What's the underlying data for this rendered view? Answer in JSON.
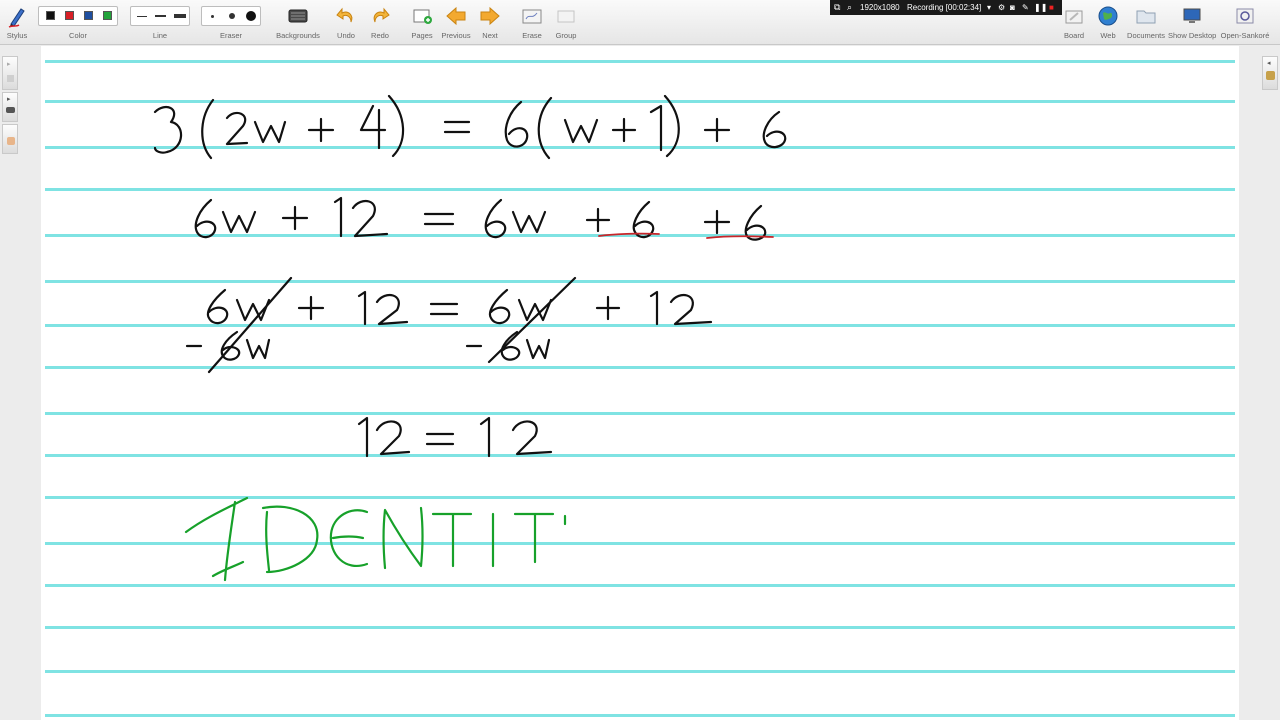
{
  "toolbar": {
    "stylus": "Stylus",
    "color": "Color",
    "line": "Line",
    "eraser": "Eraser",
    "backgrounds": "Backgrounds",
    "undo": "Undo",
    "redo": "Redo",
    "pages": "Pages",
    "previous": "Previous",
    "next": "Next",
    "erase": "Erase",
    "group": "Group",
    "board": "Board",
    "web": "Web",
    "documents": "Documents",
    "show_desktop": "Show Desktop",
    "open_sankore": "Open-Sankoré"
  },
  "colors": {
    "swatches": [
      "#111111",
      "#d81f26",
      "#1f4fa0",
      "#23a33b"
    ],
    "guideline": "#7fe3e3",
    "ink": "#111111",
    "ink_green": "#17a12a",
    "ink_red": "#c8262a"
  },
  "recording": {
    "resolution": "1920x1080",
    "status": "Recording [00:02:34]"
  },
  "board": {
    "line1": "3(2w + 4) = 6(w + 1) + 6",
    "line2": "6w + 12 = 6w + 6 + 6",
    "line3_left": "6w + 12",
    "line3_eq": "=",
    "line3_right": "6w + 12",
    "line3_sub_left": "−6w",
    "line3_sub_right": "−6w",
    "line4": "12 = 12",
    "line5": "IDENTIT"
  }
}
